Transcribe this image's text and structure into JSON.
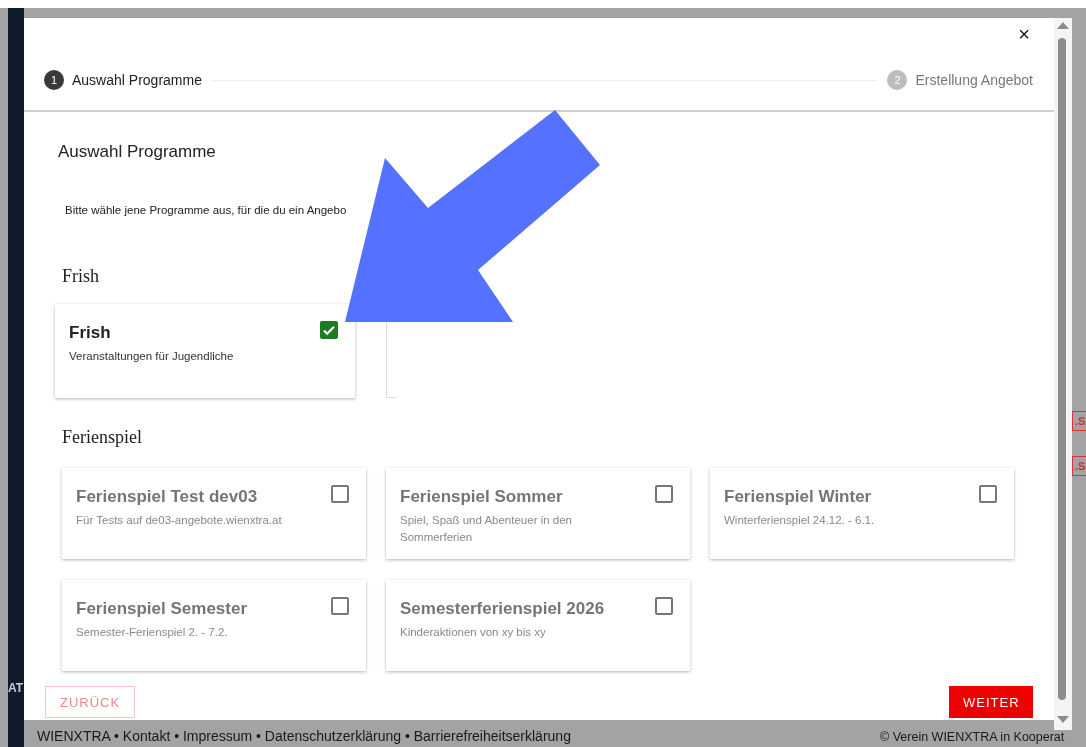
{
  "background": {
    "side_label": "AT",
    "badges": [
      ".S",
      ".S"
    ],
    "footer_links": "WIENXTRA • Kontakt • Impressum • Datenschutzerklärung • Barrierefreiheitserklärung",
    "footer_copyright": "© Verein WIENXTRA in Kooperat"
  },
  "dialog": {
    "close": "×",
    "steps": [
      {
        "number": "1",
        "label": "Auswahl Programme",
        "selected": true
      },
      {
        "number": "2",
        "label": "Erstellung Angebot",
        "selected": false
      }
    ],
    "title": "Auswahl Programme",
    "intro": "Bitte wähle jene Programme aus, für die du ein Angebo",
    "groups": [
      {
        "title": "Frish",
        "programs": [
          {
            "name": "Frish",
            "description": "Veranstaltungen für Jugendliche",
            "checked": true,
            "disabled": false
          }
        ]
      },
      {
        "title": "Ferienspiel",
        "programs": [
          {
            "name": "Ferienspiel Test dev03",
            "description": "Für Tests auf de03-angebote.wienxtra.at",
            "checked": false,
            "disabled": true
          },
          {
            "name": "Ferienspiel Sommer",
            "description": "Spiel, Spaß und Abenteuer in den Sommerferien",
            "checked": false,
            "disabled": true
          },
          {
            "name": "Ferienspiel Winter",
            "description": "Winterferienspiel 24.12. - 6.1.",
            "checked": false,
            "disabled": true
          },
          {
            "name": "Ferienspiel Semester",
            "description": "Semester-Ferienspiel 2. - 7.2.",
            "checked": false,
            "disabled": true
          },
          {
            "name": "Semesterferienspiel 2026",
            "description": "Kinderaktionen von xy bis xy",
            "checked": false,
            "disabled": true
          }
        ]
      }
    ],
    "buttons": [
      {
        "label": "ZURÜCK",
        "kind": "back",
        "disabled": true
      },
      {
        "label": "WEITER",
        "kind": "next",
        "disabled": false
      }
    ]
  }
}
